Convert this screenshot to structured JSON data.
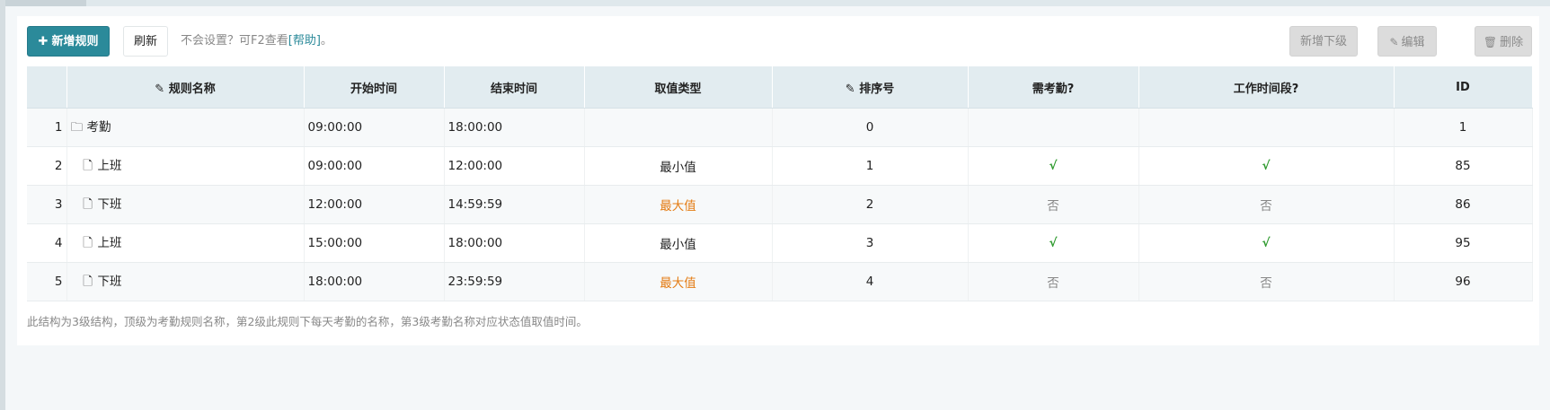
{
  "toolbar": {
    "add_label": "新增规则",
    "add_icon": "plus-icon",
    "refresh_label": "刷新",
    "hint_text": "不会设置？可F2查看",
    "help_link": "[帮助]",
    "hint_suffix": "。",
    "add_sub_label": "新增下级",
    "edit_label": "编辑",
    "delete_label": "删除"
  },
  "table": {
    "headers": {
      "rule_name": "规则名称",
      "start_time": "开始时间",
      "end_time": "结束时间",
      "value_type": "取值类型",
      "sort_no": "排序号",
      "need_attendance": "需考勤?",
      "work_period": "工作时间段?",
      "id": "ID"
    },
    "rows": [
      {
        "num": "1",
        "name": "考勤",
        "icon": "folder-icon",
        "start": "09:00:00",
        "end": "18:00:00",
        "type": "",
        "sort": "0",
        "need": "",
        "work": "",
        "id": "1"
      },
      {
        "num": "2",
        "name": "上班",
        "icon": "file-icon",
        "start": "09:00:00",
        "end": "12:00:00",
        "type": "最小值",
        "sort": "1",
        "need": "√",
        "work": "√",
        "id": "85"
      },
      {
        "num": "3",
        "name": "下班",
        "icon": "file-icon",
        "start": "12:00:00",
        "end": "14:59:59",
        "type": "最大值",
        "sort": "2",
        "need": "否",
        "work": "否",
        "id": "86"
      },
      {
        "num": "4",
        "name": "上班",
        "icon": "file-icon",
        "start": "15:00:00",
        "end": "18:00:00",
        "type": "最小值",
        "sort": "3",
        "need": "√",
        "work": "√",
        "id": "95"
      },
      {
        "num": "5",
        "name": "下班",
        "icon": "file-icon",
        "start": "18:00:00",
        "end": "23:59:59",
        "type": "最大值",
        "sort": "4",
        "need": "否",
        "work": "否",
        "id": "96"
      }
    ]
  },
  "footnote": "此结构为3级结构，顶级为考勤规则名称，第2级此规则下每天考勤的名称，第3级考勤名称对应状态值取值时间。",
  "colors": {
    "accent": "#2b8a9a",
    "max_value": "#e47b12",
    "check": "#2e9a2e"
  }
}
